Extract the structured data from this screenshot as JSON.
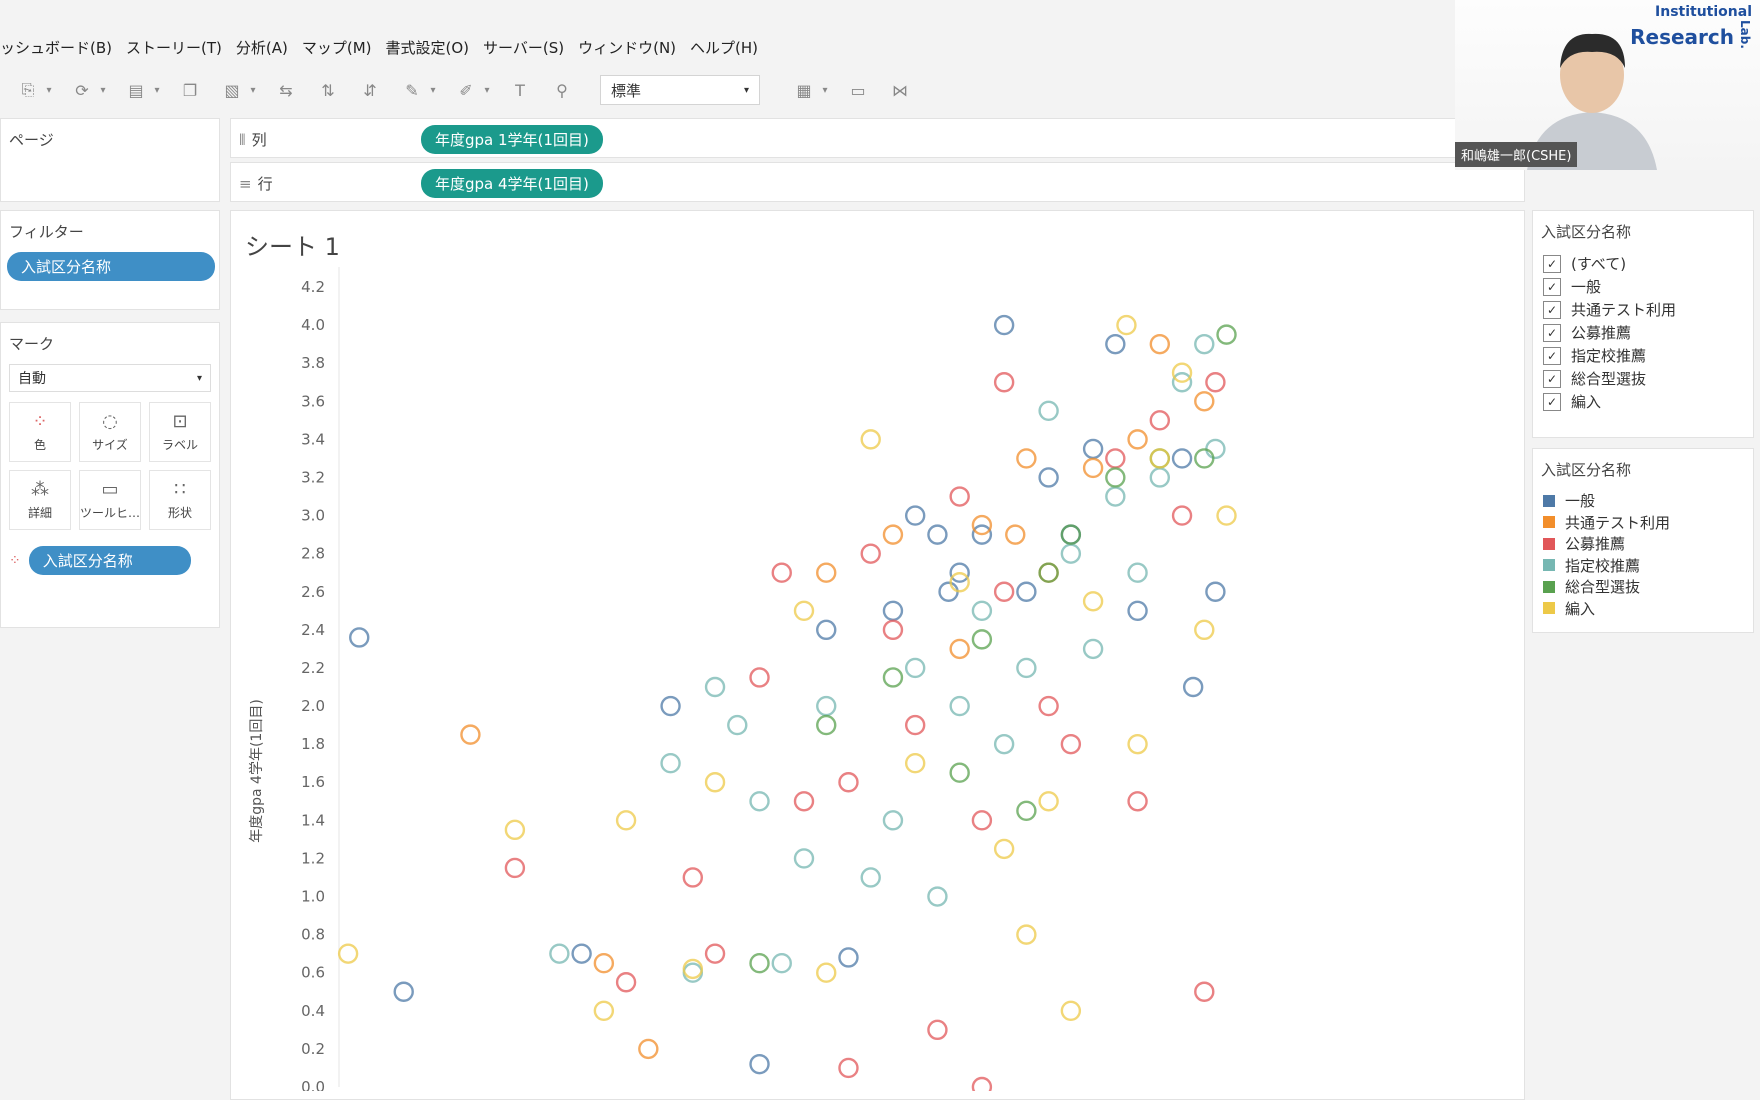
{
  "menu": [
    "ッシュボード(B)",
    "ストーリー(T)",
    "分析(A)",
    "マップ(M)",
    "書式設定(O)",
    "サーバー(S)",
    "ウィンドウ(N)",
    "ヘルプ(H)"
  ],
  "toolbar": {
    "fit_value": "標準"
  },
  "pages_panel": {
    "title": "ページ"
  },
  "filters_panel": {
    "title": "フィルター",
    "pill": "入試区分名称"
  },
  "marks_panel": {
    "title": "マーク",
    "type": "自動",
    "buttons": [
      {
        "label": "色",
        "icon": "color-icon"
      },
      {
        "label": "サイズ",
        "icon": "size-icon"
      },
      {
        "label": "ラベル",
        "icon": "label-icon"
      },
      {
        "label": "詳細",
        "icon": "detail-icon"
      },
      {
        "label": "ツールヒ…",
        "icon": "tooltip-icon"
      },
      {
        "label": "形状",
        "icon": "shape-icon"
      }
    ],
    "color_pill": "入試区分名称"
  },
  "shelves": {
    "columns": {
      "label": "列",
      "pill": "年度gpa 1学年(1回目)"
    },
    "rows": {
      "label": "行",
      "pill": "年度gpa 4学年(1回目)"
    }
  },
  "sheet": {
    "title": "シート 1"
  },
  "filter_card": {
    "title": "入試区分名称",
    "items": [
      {
        "label": "(すべて)",
        "checked": true
      },
      {
        "label": "一般",
        "checked": true
      },
      {
        "label": "共通テスト利用",
        "checked": true
      },
      {
        "label": "公募推薦",
        "checked": true
      },
      {
        "label": "指定校推薦",
        "checked": true
      },
      {
        "label": "総合型選抜",
        "checked": true
      },
      {
        "label": "編入",
        "checked": true
      }
    ]
  },
  "legend": {
    "title": "入試区分名称",
    "items": [
      {
        "label": "一般",
        "color": "#4e79a7"
      },
      {
        "label": "共通テスト利用",
        "color": "#f28e2b"
      },
      {
        "label": "公募推薦",
        "color": "#e15759"
      },
      {
        "label": "指定校推薦",
        "color": "#76b7b2"
      },
      {
        "label": "総合型選抜",
        "color": "#59a14f"
      },
      {
        "label": "編入",
        "color": "#edc948"
      }
    ]
  },
  "video": {
    "name": "和嶋雄一郎(CSHE)",
    "logo_line1": "Institutional",
    "logo_line2": "Research",
    "logo_line3": "Lab."
  },
  "chart_data": {
    "type": "scatter",
    "title": "シート 1",
    "ylabel": "年度gpa 4学年(1回目)",
    "xlabel": "",
    "ylim": [
      0,
      4.2
    ],
    "yticks": [
      0.0,
      0.2,
      0.4,
      0.6,
      0.8,
      1.0,
      1.2,
      1.4,
      1.6,
      1.8,
      2.0,
      2.2,
      2.4,
      2.6,
      2.8,
      3.0,
      3.2,
      3.4,
      3.6,
      3.8,
      4.0,
      4.2
    ],
    "marker": "open-circle",
    "series": [
      {
        "name": "一般",
        "color": "#4e79a7",
        "points": [
          [
            0.1,
            2.36
          ],
          [
            0.3,
            0.5
          ],
          [
            1.1,
            0.7
          ],
          [
            1.5,
            2.0
          ],
          [
            1.9,
            0.12
          ],
          [
            2.2,
            2.4
          ],
          [
            2.3,
            0.68
          ],
          [
            2.5,
            2.5
          ],
          [
            2.6,
            3.0
          ],
          [
            2.7,
            2.9
          ],
          [
            2.8,
            2.7
          ],
          [
            2.9,
            2.9
          ],
          [
            3.0,
            4.0
          ],
          [
            3.2,
            3.2
          ],
          [
            3.4,
            3.35
          ],
          [
            3.6,
            2.5
          ],
          [
            3.8,
            3.3
          ],
          [
            3.1,
            2.6
          ],
          [
            3.3,
            2.9
          ],
          [
            2.75,
            2.6
          ],
          [
            3.5,
            3.9
          ],
          [
            3.95,
            2.6
          ],
          [
            3.85,
            2.1
          ]
        ]
      },
      {
        "name": "共通テスト利用",
        "color": "#f28e2b",
        "points": [
          [
            0.6,
            1.85
          ],
          [
            1.2,
            0.65
          ],
          [
            1.4,
            0.2
          ],
          [
            2.2,
            2.7
          ],
          [
            2.5,
            2.9
          ],
          [
            2.8,
            2.3
          ],
          [
            2.9,
            2.95
          ],
          [
            3.05,
            2.9
          ],
          [
            3.1,
            3.3
          ],
          [
            3.2,
            2.7
          ],
          [
            3.4,
            3.25
          ],
          [
            3.6,
            3.4
          ],
          [
            3.7,
            3.9
          ],
          [
            3.9,
            3.6
          ]
        ]
      },
      {
        "name": "公募推薦",
        "color": "#e15759",
        "points": [
          [
            0.8,
            1.15
          ],
          [
            1.3,
            0.55
          ],
          [
            1.6,
            1.1
          ],
          [
            1.7,
            0.7
          ],
          [
            1.9,
            2.15
          ],
          [
            2.0,
            2.7
          ],
          [
            2.1,
            1.5
          ],
          [
            2.3,
            1.6
          ],
          [
            2.3,
            0.1
          ],
          [
            2.4,
            2.8
          ],
          [
            2.5,
            2.4
          ],
          [
            2.6,
            1.9
          ],
          [
            2.7,
            0.3
          ],
          [
            2.8,
            3.1
          ],
          [
            2.9,
            1.4
          ],
          [
            2.9,
            0.0
          ],
          [
            3.0,
            2.6
          ],
          [
            3.0,
            3.7
          ],
          [
            3.2,
            2.0
          ],
          [
            3.3,
            1.8
          ],
          [
            3.5,
            3.3
          ],
          [
            3.6,
            1.5
          ],
          [
            3.7,
            3.5
          ],
          [
            3.8,
            3.0
          ],
          [
            3.9,
            0.5
          ],
          [
            3.95,
            3.7
          ]
        ]
      },
      {
        "name": "指定校推薦",
        "color": "#76b7b2",
        "points": [
          [
            1.0,
            0.7
          ],
          [
            1.5,
            1.7
          ],
          [
            1.6,
            0.6
          ],
          [
            1.7,
            2.1
          ],
          [
            1.8,
            1.9
          ],
          [
            1.9,
            1.5
          ],
          [
            2.0,
            0.65
          ],
          [
            2.1,
            1.2
          ],
          [
            2.2,
            2.0
          ],
          [
            2.4,
            1.1
          ],
          [
            2.5,
            1.4
          ],
          [
            2.6,
            2.2
          ],
          [
            2.7,
            1.0
          ],
          [
            2.8,
            2.0
          ],
          [
            2.9,
            2.5
          ],
          [
            3.0,
            1.8
          ],
          [
            3.1,
            2.2
          ],
          [
            3.2,
            3.55
          ],
          [
            3.3,
            2.8
          ],
          [
            3.4,
            2.3
          ],
          [
            3.5,
            3.1
          ],
          [
            3.6,
            2.7
          ],
          [
            3.7,
            3.2
          ],
          [
            3.8,
            3.7
          ],
          [
            3.9,
            3.9
          ],
          [
            3.95,
            3.35
          ]
        ]
      },
      {
        "name": "総合型選抜",
        "color": "#59a14f",
        "points": [
          [
            1.9,
            0.65
          ],
          [
            2.2,
            1.9
          ],
          [
            2.5,
            2.15
          ],
          [
            2.8,
            1.65
          ],
          [
            2.9,
            2.35
          ],
          [
            3.1,
            1.45
          ],
          [
            3.2,
            2.7
          ],
          [
            3.3,
            2.9
          ],
          [
            3.5,
            3.2
          ],
          [
            3.7,
            3.3
          ],
          [
            3.9,
            3.3
          ],
          [
            4.0,
            3.95
          ]
        ]
      },
      {
        "name": "編入",
        "color": "#edc948",
        "points": [
          [
            0.05,
            0.7
          ],
          [
            0.8,
            1.35
          ],
          [
            1.2,
            0.4
          ],
          [
            1.3,
            1.4
          ],
          [
            1.7,
            1.6
          ],
          [
            1.6,
            0.62
          ],
          [
            2.1,
            2.5
          ],
          [
            2.2,
            0.6
          ],
          [
            2.4,
            3.4
          ],
          [
            2.6,
            1.7
          ],
          [
            2.8,
            2.65
          ],
          [
            3.0,
            1.25
          ],
          [
            3.1,
            0.8
          ],
          [
            3.2,
            1.5
          ],
          [
            3.3,
            0.4
          ],
          [
            3.4,
            2.55
          ],
          [
            3.6,
            1.8
          ],
          [
            3.7,
            3.3
          ],
          [
            3.8,
            3.75
          ],
          [
            3.9,
            2.4
          ],
          [
            4.0,
            3.0
          ],
          [
            3.55,
            4.0
          ]
        ]
      }
    ]
  }
}
